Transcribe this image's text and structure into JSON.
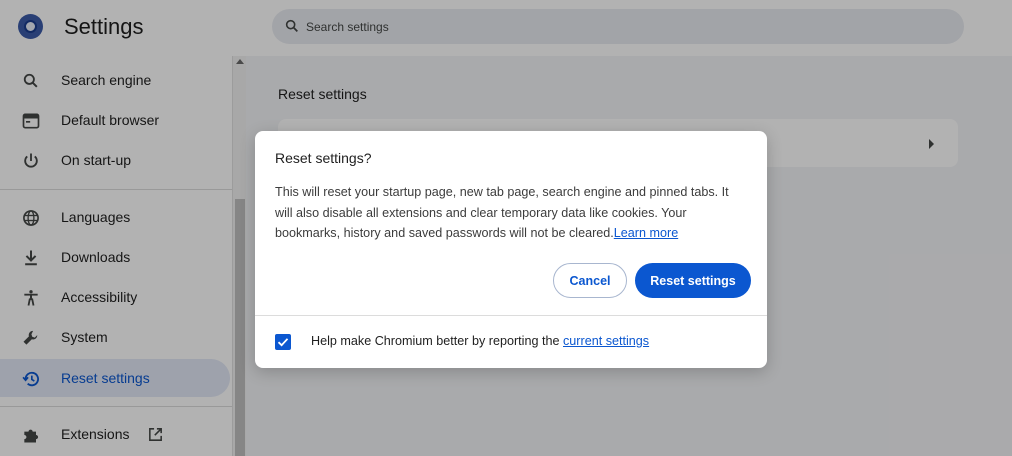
{
  "header": {
    "app_title": "Settings",
    "search_placeholder": "Search settings",
    "logo_icon": "chromium-logo-icon",
    "search_icon": "search-icon"
  },
  "sidebar": {
    "items": [
      {
        "label": "Search engine",
        "icon": "search-icon",
        "active": false
      },
      {
        "label": "Default browser",
        "icon": "browser-window-icon",
        "active": false
      },
      {
        "label": "On start-up",
        "icon": "power-icon",
        "active": false
      },
      {
        "label": "Languages",
        "icon": "globe-icon",
        "active": false
      },
      {
        "label": "Downloads",
        "icon": "download-icon",
        "active": false
      },
      {
        "label": "Accessibility",
        "icon": "accessibility-icon",
        "active": false
      },
      {
        "label": "System",
        "icon": "wrench-icon",
        "active": false
      },
      {
        "label": "Reset settings",
        "icon": "history-icon",
        "active": true
      },
      {
        "label": "Extensions",
        "icon": "puzzle-icon",
        "active": false
      }
    ],
    "extensions_external_icon": "open-in-new-icon"
  },
  "main": {
    "section_title": "Reset settings"
  },
  "dialog": {
    "title": "Reset settings?",
    "body_text": "This will reset your startup page, new tab page, search engine and pinned tabs. It will also disable all extensions and clear temporary data like cookies. Your bookmarks, history and saved passwords will not be cleared.",
    "learn_more": "Learn more",
    "cancel_label": "Cancel",
    "reset_label": "Reset settings",
    "checkbox_checked": true,
    "checkbox_text": "Help make Chromium better by reporting the ",
    "checkbox_link": "current settings"
  },
  "colors": {
    "accent": "#0b57d0",
    "active_nav_bg": "#e2e8f6",
    "search_bg": "#e9ebf1"
  }
}
